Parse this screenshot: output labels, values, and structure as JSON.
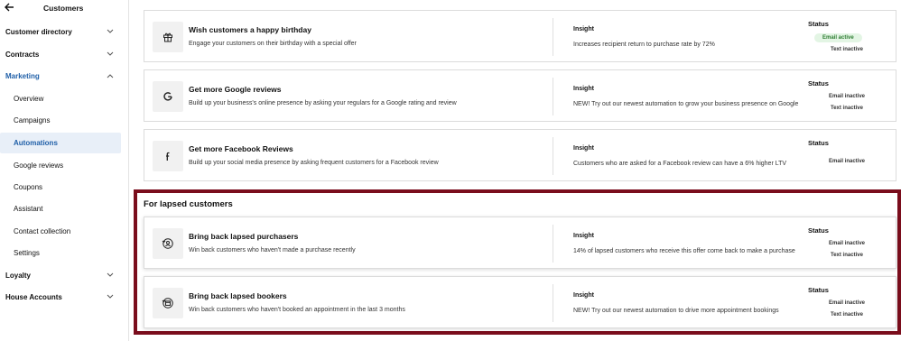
{
  "sidebar": {
    "title": "Customers",
    "items": [
      {
        "label": "Customer directory"
      },
      {
        "label": "Contracts"
      },
      {
        "label": "Marketing"
      },
      {
        "label": "Overview"
      },
      {
        "label": "Campaigns"
      },
      {
        "label": "Automations"
      },
      {
        "label": "Google reviews"
      },
      {
        "label": "Coupons"
      },
      {
        "label": "Assistant"
      },
      {
        "label": "Contact collection"
      },
      {
        "label": "Settings"
      },
      {
        "label": "Loyalty"
      },
      {
        "label": "House Accounts"
      }
    ]
  },
  "section": {
    "title": "For lapsed customers"
  },
  "cards": [
    {
      "icon": "gift-icon",
      "title": "Wish customers a happy birthday",
      "desc": "Engage your customers on their birthday with a special offer",
      "insight_label": "Insight",
      "insight": "Increases recipient return to purchase rate by 72%",
      "status_label": "Status",
      "status_1": "Email active",
      "status_2": "Text inactive"
    },
    {
      "icon": "google-icon",
      "title": "Get more Google reviews",
      "desc": "Build up your business's online presence by asking your regulars for a Google rating and review",
      "insight_label": "Insight",
      "insight": "NEW! Try out our newest automation to grow your business presence on Google",
      "status_label": "Status",
      "status_1": "Email inactive",
      "status_2": "Text inactive"
    },
    {
      "icon": "facebook-icon",
      "title": "Get more Facebook Reviews",
      "desc": "Build up your social media presence by asking frequent customers for a Facebook review",
      "insight_label": "Insight",
      "insight": "Customers who are asked for a Facebook review can have a 6% higher LTV",
      "status_label": "Status",
      "status_1": "Email inactive"
    },
    {
      "icon": "lapsed-purchaser-icon",
      "title": "Bring back lapsed purchasers",
      "desc": "Win back customers who haven't made a purchase recently",
      "insight_label": "Insight",
      "insight": "14% of lapsed customers who receive this offer come back to make a purchase",
      "status_label": "Status",
      "status_1": "Email inactive",
      "status_2": "Text inactive"
    },
    {
      "icon": "lapsed-booker-icon",
      "title": "Bring back lapsed bookers",
      "desc": "Win back customers who haven't booked an appointment in the last 3 months",
      "insight_label": "Insight",
      "insight": "NEW! Try out our newest automation to drive more appointment bookings",
      "status_label": "Status",
      "status_1": "Email inactive",
      "status_2": "Text inactive"
    }
  ]
}
